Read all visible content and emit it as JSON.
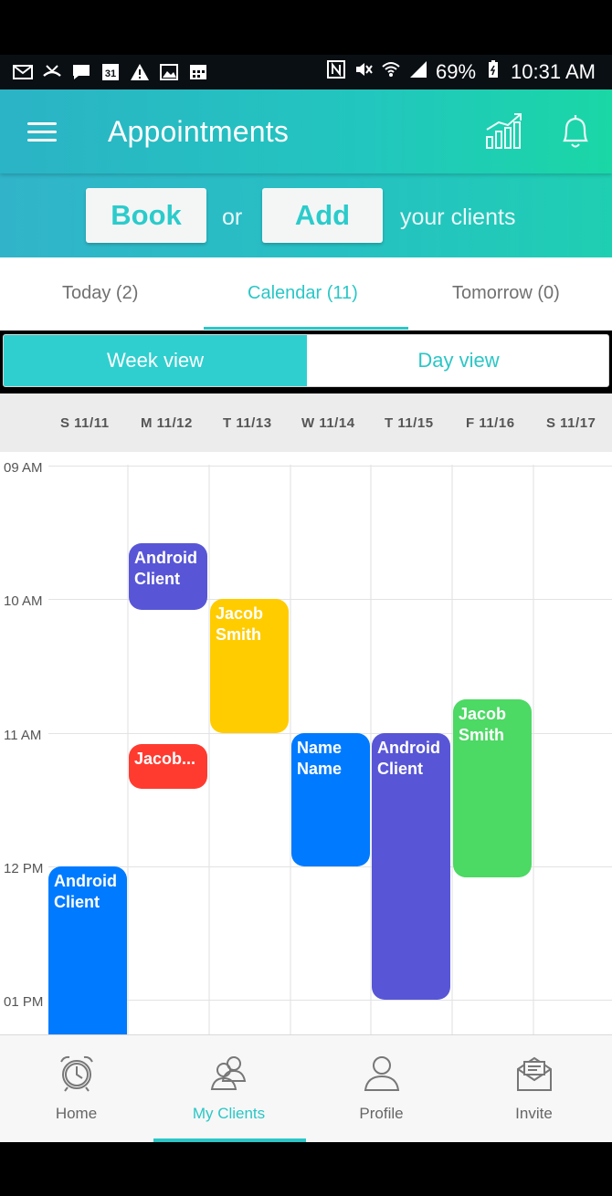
{
  "status_bar": {
    "battery": "69%",
    "time": "10:31 AM",
    "calendar_day": "31"
  },
  "app_bar": {
    "title": "Appointments",
    "menu_icon": "menu-icon",
    "analytics_icon": "analytics-chart-icon",
    "notification_icon": "bell-icon"
  },
  "booking_bar": {
    "book_label": "Book",
    "or_text": "or",
    "add_label": "Add",
    "clients_text": "your clients"
  },
  "tabs": [
    {
      "label": "Today (2)",
      "active": false
    },
    {
      "label": "Calendar (11)",
      "active": true
    },
    {
      "label": "Tomorrow (0)",
      "active": false
    }
  ],
  "view_toggle": {
    "week_label": "Week view",
    "day_label": "Day view",
    "selected": "Week view"
  },
  "days": [
    "S 11/11",
    "M 11/12",
    "T 11/13",
    "W 11/14",
    "T 11/15",
    "F 11/16",
    "S 11/17"
  ],
  "time_labels": [
    "09 AM",
    "10 AM",
    "11 AM",
    "12 PM",
    "01 PM"
  ],
  "events": [
    {
      "text": "Android Client",
      "day": "M 11/12",
      "start": "9:35",
      "end": "10:05",
      "color": "#5856d6"
    },
    {
      "text": "Jacob Smith",
      "day": "T 11/13",
      "start": "10:00",
      "end": "11:00",
      "color": "#ffcc00"
    },
    {
      "text": "Jacob...",
      "day": "M 11/12",
      "start": "11:05",
      "end": "11:25",
      "color": "#ff3b30"
    },
    {
      "text": "Name Name",
      "day": "W 11/14",
      "start": "11:00",
      "end": "12:00",
      "color": "#007aff"
    },
    {
      "text": "Android Client",
      "day": "T 11/15",
      "start": "11:00",
      "end": "13:00",
      "color": "#5856d6"
    },
    {
      "text": "Jacob Smith",
      "day": "F 11/16",
      "start": "10:45",
      "end": "12:05",
      "color": "#4cd964"
    },
    {
      "text": "Android Client",
      "day": "S 11/11",
      "start": "12:00",
      "end": "13:30",
      "color": "#007aff"
    }
  ],
  "bottom_nav": [
    {
      "label": "Home",
      "icon": "alarm-clock-icon",
      "active": false
    },
    {
      "label": "My Clients",
      "icon": "users-icon",
      "active": true
    },
    {
      "label": "Profile",
      "icon": "user-icon",
      "active": false
    },
    {
      "label": "Invite",
      "icon": "envelope-icon",
      "active": false
    }
  ],
  "colors": {
    "accent": "#2bc6c6",
    "header_gradient_start": "#2bb3c6",
    "header_gradient_end": "#1ad7a6"
  }
}
